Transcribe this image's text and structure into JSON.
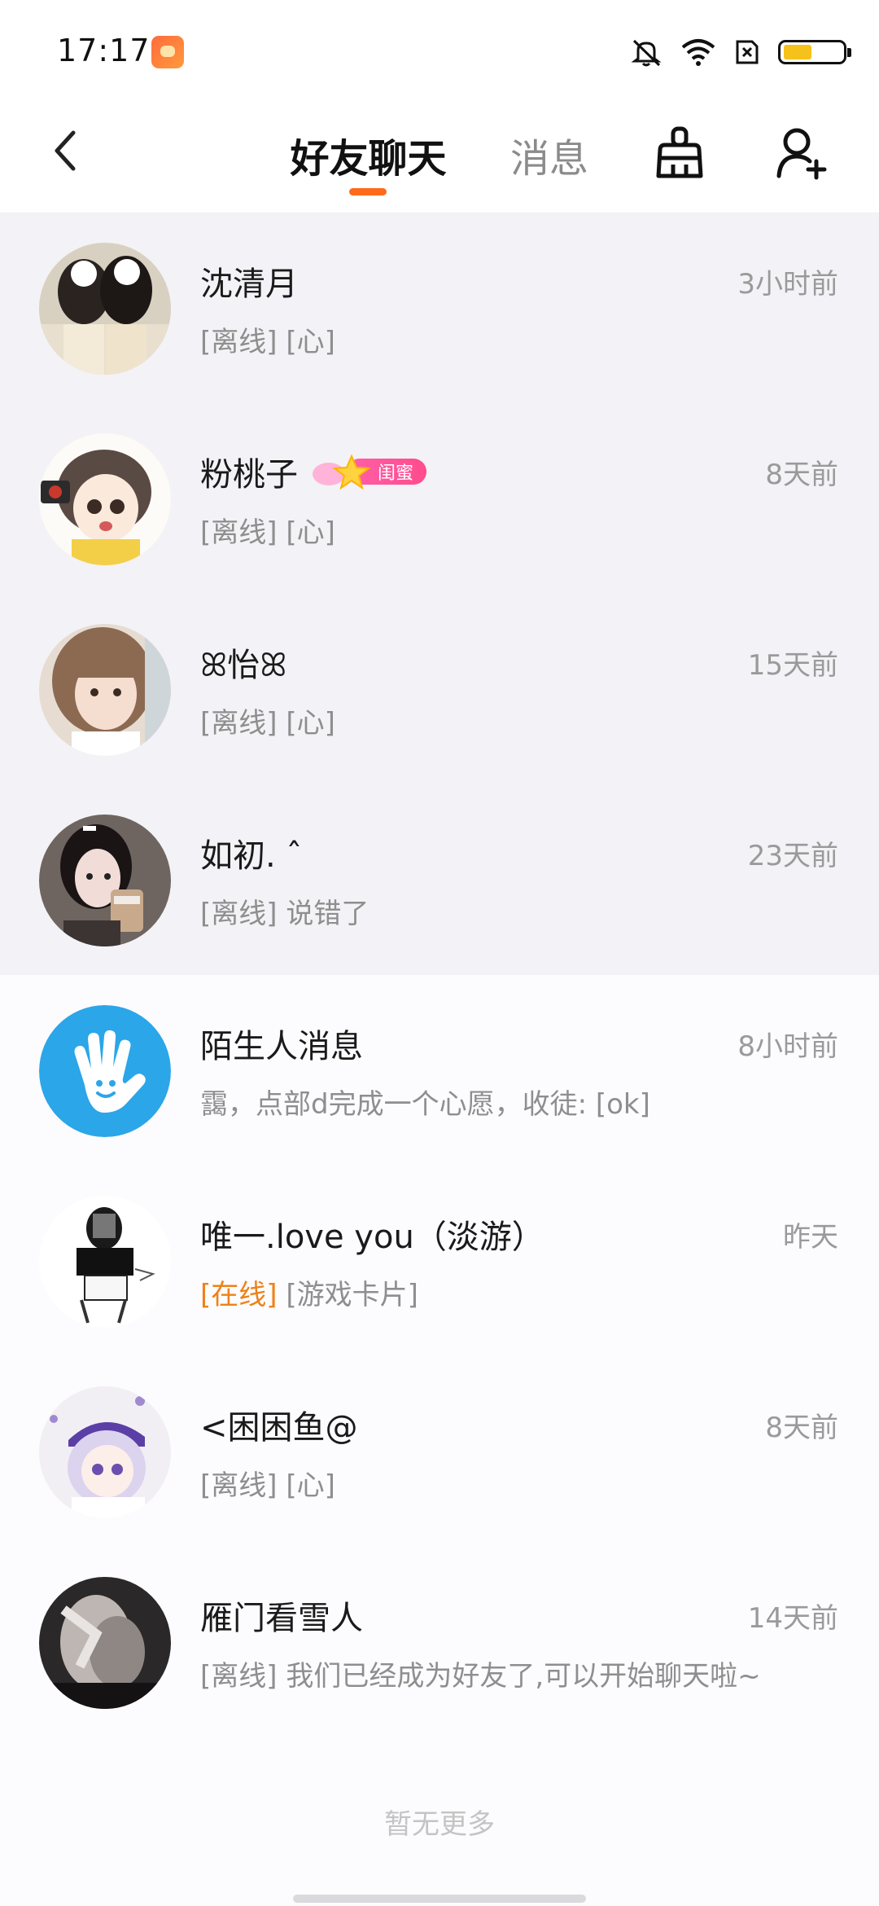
{
  "status_bar": {
    "time": "17:17",
    "icons": [
      "app-notification-icon",
      "mute-icon",
      "wifi-icon",
      "sim-off-icon",
      "battery-icon"
    ]
  },
  "header": {
    "back_icon": "chevron-left-icon",
    "tab_friends": "好友聊天",
    "tab_messages": "消息",
    "clean_icon": "broom-icon",
    "add_friend_icon": "add-user-icon",
    "accent": "#ff6a1a"
  },
  "chats": [
    {
      "name": "沈清月",
      "time": "3小时前",
      "status": "[离线]",
      "message": "[心]"
    },
    {
      "name": "粉桃子",
      "badge": "闺蜜",
      "time": "8天前",
      "status": "[离线]",
      "message": "[心]"
    },
    {
      "name": "ꕤ怡ꕤ",
      "time": "15天前",
      "status": "[离线]",
      "message": "[心]"
    },
    {
      "name": "如初. ˆ",
      "time": "23天前",
      "status": "[离线]",
      "message": "说错了"
    },
    {
      "name": "陌生人消息",
      "time": "8小时前",
      "status": "",
      "message": "靄，点部d完成一个心愿，收徒: [ok]"
    },
    {
      "name": "唯一.love you（淡游）",
      "time": "昨天",
      "status": "[在线]",
      "message": "[游戏卡片]"
    },
    {
      "name": "<困困鱼@",
      "time": "8天前",
      "status": "[离线]",
      "message": "[心]"
    },
    {
      "name": "雁门看雪人",
      "time": "14天前",
      "status": "[离线]",
      "message": "我们已经成为好友了,可以开始聊天啦~"
    }
  ],
  "footer": "暂无更多",
  "colors": {
    "online": "#ee8118",
    "pinned_bg": "#f3f2f6",
    "stranger": "#2ba6e8"
  }
}
